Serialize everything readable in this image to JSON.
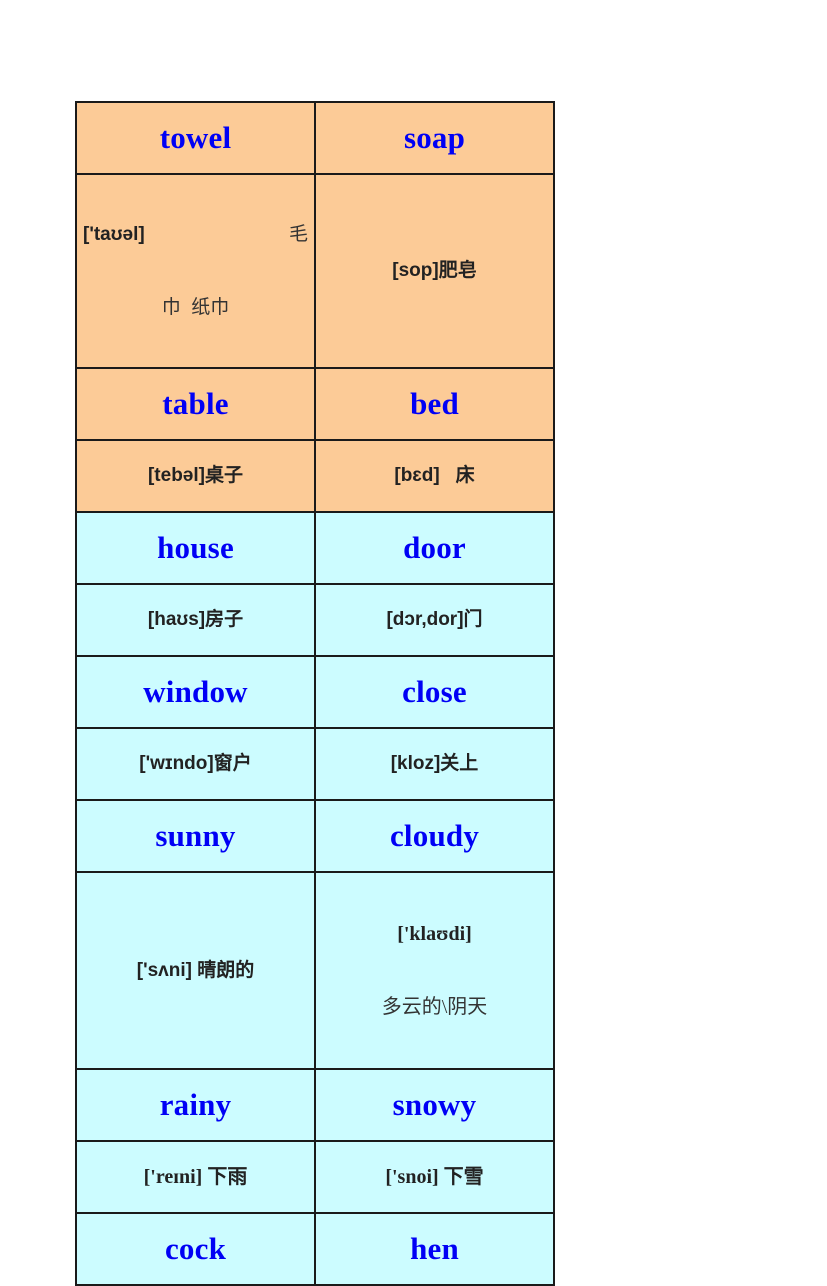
{
  "sheet": {
    "colors": {
      "orange_fill": "#FCCB97",
      "cyan_fill": "#CCFCFF",
      "word_blue": "#0000F5",
      "border": "#1A1A1A",
      "gloss_black": "#222222",
      "page_background": "#FFFFFF"
    },
    "columns": 2,
    "rows": 12
  },
  "entries": [
    {
      "word": "towel",
      "ipa": "['taʊəl]",
      "cn_right": "毛",
      "cn_second_line": "巾  纸巾",
      "tint": "orange",
      "style": "split",
      "font": "sans"
    },
    {
      "word": "soap",
      "ipa": "[sop]",
      "cn": "肥皂",
      "gloss": "[sop]肥皂",
      "tint": "orange",
      "style": "inline",
      "font": "sans"
    },
    {
      "word": "table",
      "ipa": "[tebəl]",
      "cn": "桌子",
      "gloss": "[tebəl]桌子",
      "tint": "orange",
      "style": "inline",
      "font": "sans"
    },
    {
      "word": "bed",
      "ipa": "[bɛd]",
      "cn": "床",
      "gloss": "[bɛd]   床",
      "tint": "orange",
      "style": "inline",
      "font": "sans"
    },
    {
      "word": "house",
      "ipa": "[haʊs]",
      "cn": "房子",
      "gloss": "[haʊs]房子",
      "tint": "cyan",
      "style": "inline",
      "font": "sans"
    },
    {
      "word": "door",
      "ipa": "[dɔr,dor]",
      "cn": "门",
      "gloss": "[dɔr,dor]门",
      "tint": "cyan",
      "style": "inline",
      "font": "sans"
    },
    {
      "word": "window",
      "ipa": "['wɪndo]",
      "cn": "窗户",
      "gloss": "['wɪndo]窗户",
      "tint": "cyan",
      "style": "inline",
      "font": "sans"
    },
    {
      "word": "close",
      "ipa": "[kloz]",
      "cn": "关上",
      "gloss": "[kloz]关上",
      "tint": "cyan",
      "style": "inline",
      "font": "sans"
    },
    {
      "word": "sunny",
      "ipa": "['sʌni]",
      "cn": "晴朗的",
      "gloss": "['sʌni] 晴朗的",
      "tint": "cyan",
      "style": "inline",
      "font": "sans"
    },
    {
      "word": "cloudy",
      "ipa": "['klaʊdi]",
      "cn": "多云的\\阴天",
      "tint": "cyan",
      "style": "stacked",
      "font": "serif"
    },
    {
      "word": "rainy",
      "ipa": "['reɪni]",
      "cn": "下雨",
      "gloss": "['reɪni] 下雨",
      "tint": "cyan",
      "style": "inline",
      "font": "serif"
    },
    {
      "word": "snowy",
      "ipa": "['snoi]",
      "cn": "下雪",
      "gloss": "['snoi] 下雪",
      "tint": "cyan",
      "style": "inline",
      "font": "serif"
    },
    {
      "word": "cock",
      "tint": "cyan"
    },
    {
      "word": "hen",
      "tint": "cyan"
    }
  ],
  "grid": {
    "row1": {
      "left_word": "towel",
      "right_word": "soap"
    },
    "row3": {
      "left_word": "table",
      "right_word": "bed"
    },
    "row5": {
      "left_word": "house",
      "right_word": "door"
    },
    "row7": {
      "left_word": "window",
      "right_word": "close"
    },
    "row9": {
      "left_word": "sunny",
      "right_word": "cloudy"
    },
    "row11": {
      "left_word": "rainy",
      "right_word": "snowy"
    },
    "row13": {
      "left_word": "cock",
      "right_word": "hen"
    }
  }
}
